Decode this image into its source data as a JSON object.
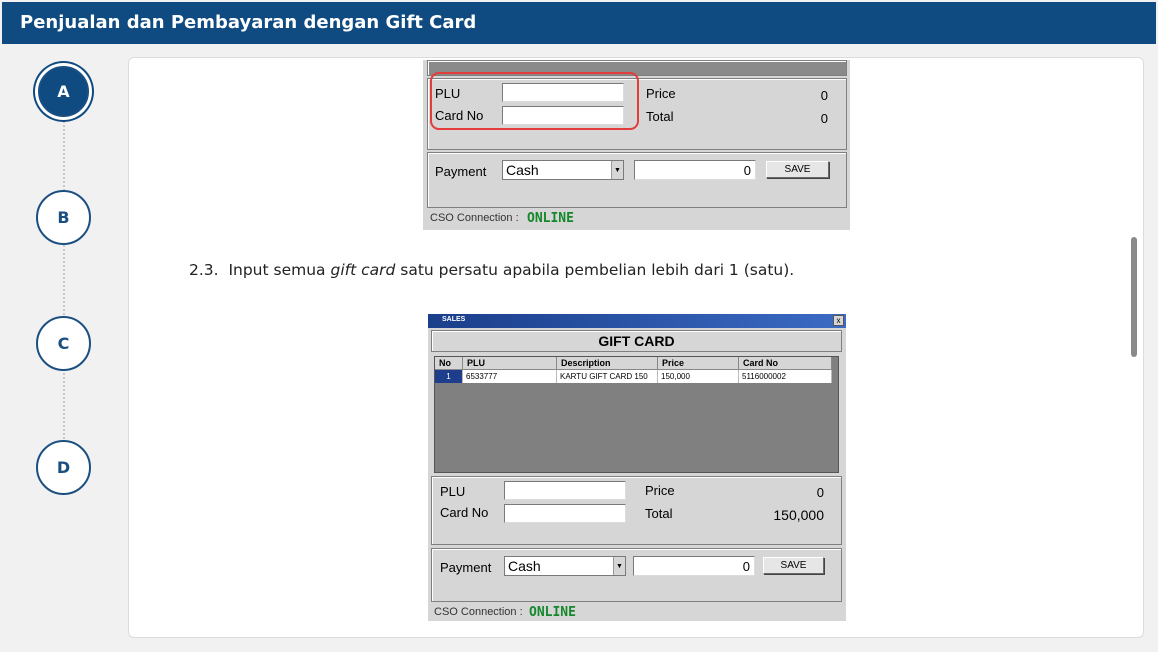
{
  "header": {
    "title": "Penjualan dan Pembayaran dengan Gift Card"
  },
  "steps": [
    {
      "label": "A",
      "active": true
    },
    {
      "label": "B",
      "active": false
    },
    {
      "label": "C",
      "active": false
    },
    {
      "label": "D",
      "active": false
    }
  ],
  "top_form": {
    "plu_label": "PLU",
    "card_no_label": "Card No",
    "price_label": "Price",
    "price_value": "0",
    "total_label": "Total",
    "total_value": "0",
    "payment_label": "Payment",
    "payment_method": "Cash",
    "amount_value": "0",
    "save_label": "SAVE",
    "connection_label": "CSO Connection :",
    "connection_status": "ONLINE"
  },
  "instruction": {
    "number": "2.3.",
    "text_before": "Input semua",
    "emphasis": "gift card",
    "text_after": "satu persatu apabila pembelian lebih dari 1 (satu)."
  },
  "gift_card_window": {
    "window_title": "SALES",
    "close_label": "x",
    "heading": "GIFT CARD",
    "columns": [
      "No",
      "PLU",
      "Description",
      "Price",
      "Card No"
    ],
    "rows": [
      [
        "1",
        "6533777",
        "KARTU GIFT CARD 150",
        "150,000",
        "5116000002"
      ]
    ],
    "plu_label": "PLU",
    "card_no_label": "Card No",
    "price_label": "Price",
    "price_value": "0",
    "total_label": "Total",
    "total_value": "150,000",
    "payment_label": "Payment",
    "payment_method": "Cash",
    "amount_value": "0",
    "save_label": "SAVE",
    "connection_label": "CSO Connection :",
    "connection_status": "ONLINE"
  },
  "colors": {
    "header_bg": "#0f4b81",
    "highlight": "#e23c3c",
    "online": "#14882a"
  }
}
